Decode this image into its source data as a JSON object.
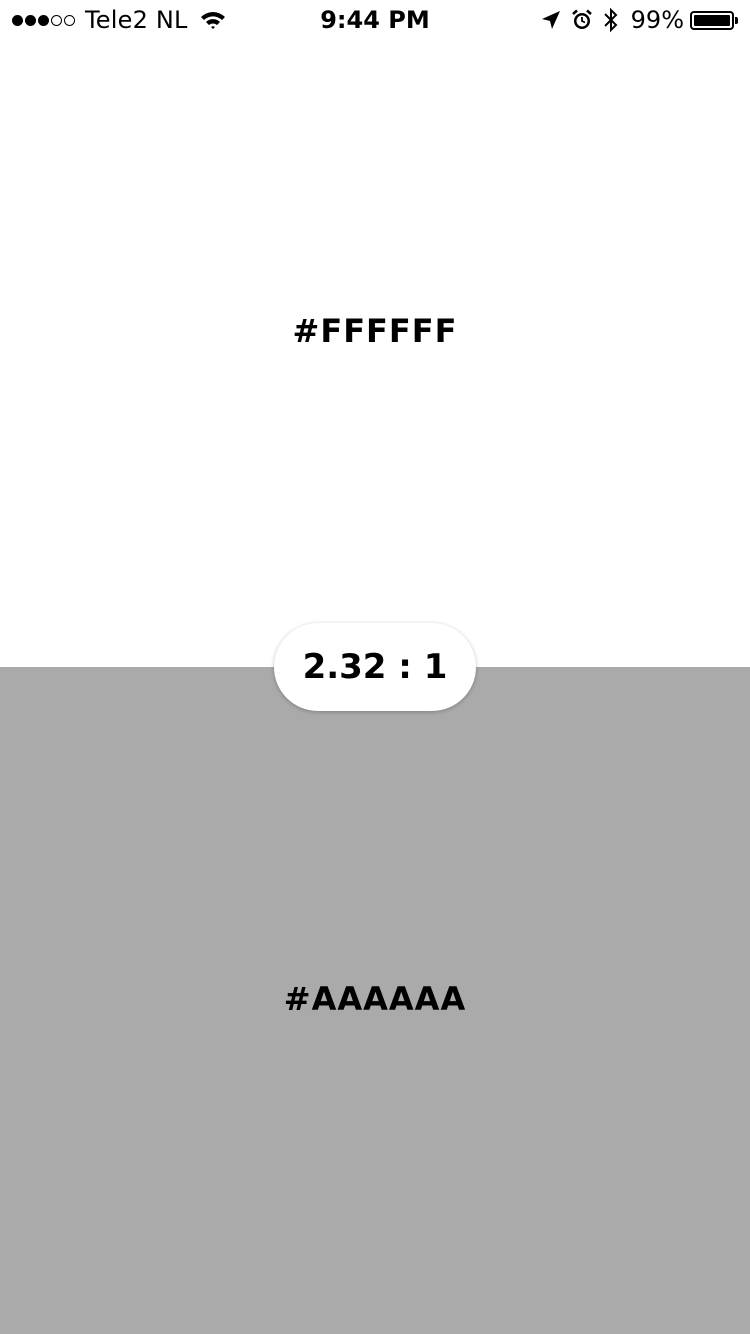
{
  "status_bar": {
    "signal_strength": 3,
    "signal_total": 5,
    "carrier": "Tele2 NL",
    "time": "9:44 PM",
    "battery_percent": "99%",
    "battery_level": 0.99,
    "icons": [
      "wifi-icon",
      "location-arrow-icon",
      "alarm-icon",
      "bluetooth-icon",
      "battery-icon"
    ]
  },
  "top_color": {
    "hex": "#FFFFFF",
    "label": "#FFFFFF"
  },
  "contrast": {
    "ratio_label": "2.32 : 1"
  },
  "bottom_color": {
    "hex": "#AAAAAA",
    "label": "#AAAAAA"
  }
}
